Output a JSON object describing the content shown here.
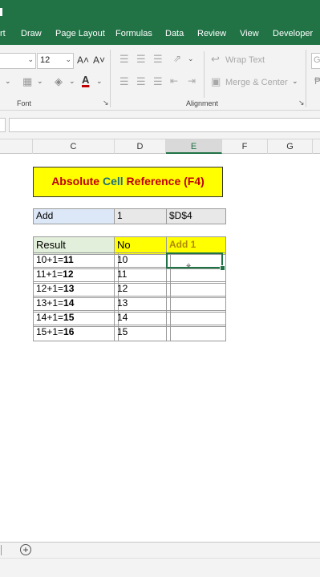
{
  "ribbon_tabs": [
    "rt",
    "Draw",
    "Page Layout",
    "Formulas",
    "Data",
    "Review",
    "View",
    "Developer"
  ],
  "ribbon": {
    "font_size": "12",
    "grow_font": "A˄",
    "shrink_font": "A˅",
    "wrap_text": "Wrap Text",
    "merge_center": "Merge & Center",
    "font_group_label": "Font",
    "alignment_group_label": "Alignment",
    "general_fragment": "G"
  },
  "columns": [
    "C",
    "D",
    "E",
    "F",
    "G"
  ],
  "sheet": {
    "title_part1": "Absolute ",
    "title_part2": "Cell ",
    "title_part3": "Reference (F4)",
    "add_label": "Add",
    "add_value": "1",
    "add_ref": "$D$4",
    "headers": {
      "result": "Result",
      "no": "No",
      "add1": "Add 1"
    },
    "rows": [
      {
        "expr": "10+1=",
        "answer": "11",
        "no": "10"
      },
      {
        "expr": "11+1=",
        "answer": "12",
        "no": "11"
      },
      {
        "expr": "12+1=",
        "answer": "13",
        "no": "12"
      },
      {
        "expr": "13+1=",
        "answer": "14",
        "no": "13"
      },
      {
        "expr": "14+1=",
        "answer": "15",
        "no": "14"
      },
      {
        "expr": "15+1=",
        "answer": "16",
        "no": "15"
      }
    ]
  },
  "colors": {
    "excel_green": "#217346",
    "title_yellow": "#ffff00",
    "title_red": "#c00000",
    "title_teal": "#1e6f7a"
  }
}
